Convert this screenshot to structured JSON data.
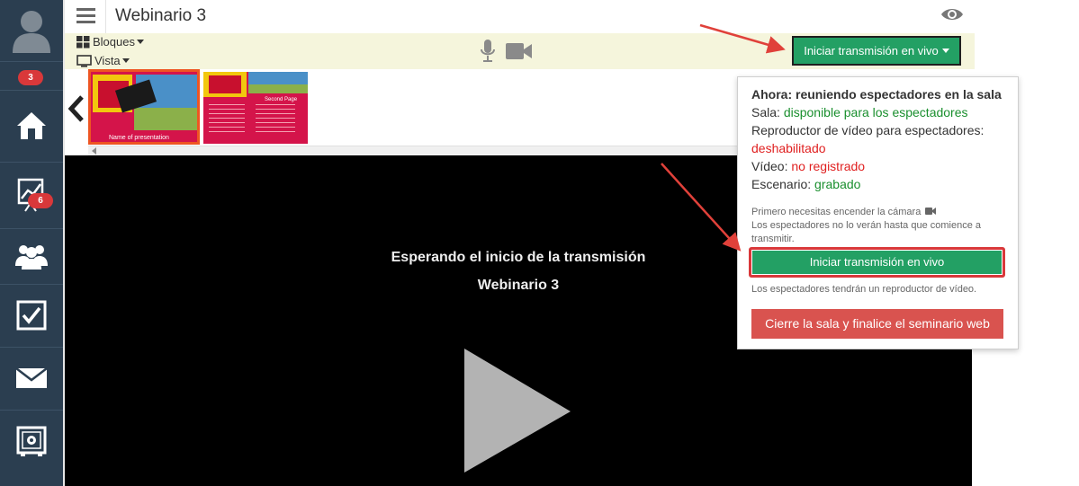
{
  "sidebar": {
    "badges": [
      "3",
      "6"
    ],
    "items": [
      {
        "icon": "user-avatar-icon"
      },
      {
        "icon": "home-icon"
      },
      {
        "icon": "chart-presentation-icon"
      },
      {
        "icon": "users-icon"
      },
      {
        "icon": "checkbox-icon"
      },
      {
        "icon": "mail-icon"
      },
      {
        "icon": "safe-icon"
      }
    ]
  },
  "header": {
    "title": "Webinario 3"
  },
  "toolbar": {
    "blocks_label": "Bloques",
    "view_label": "Vista",
    "live_button_label": "Iniciar transmisión en vivo"
  },
  "thumbnails": [
    {
      "title": "Name of presentation"
    },
    {
      "title": "Second Page"
    }
  ],
  "stage": {
    "waiting_text": "Esperando el inicio de la transmisión",
    "webinar_name": "Webinario 3"
  },
  "popover": {
    "heading": "Ahora: reuniendo espectadores en la sala",
    "room_label": "Sala:",
    "room_value": "disponible para los espectadores",
    "player_label": "Reproductor de vídeo para espectadores:",
    "player_value": "deshabilitado",
    "video_label": "Vídeo:",
    "video_value": "no registrado",
    "scenario_label": "Escenario:",
    "scenario_value": "grabado",
    "note_line1": "Primero necesitas encender la cámara",
    "note_line2": "Los espectadores no lo verán hasta que comience a transmitir.",
    "start_button": "Iniciar transmisión en vivo",
    "player_note": "Los espectadores tendrán un reproductor de vídeo.",
    "close_button": "Cierre la sala y finalice el seminario web"
  },
  "colors": {
    "sidebar": "#2b3e50",
    "toolbar_bg": "#f5f5dc",
    "start_button": "#23a064",
    "close_button": "#d9534f",
    "badge": "#d9383a",
    "arrow": "#e0413a"
  }
}
